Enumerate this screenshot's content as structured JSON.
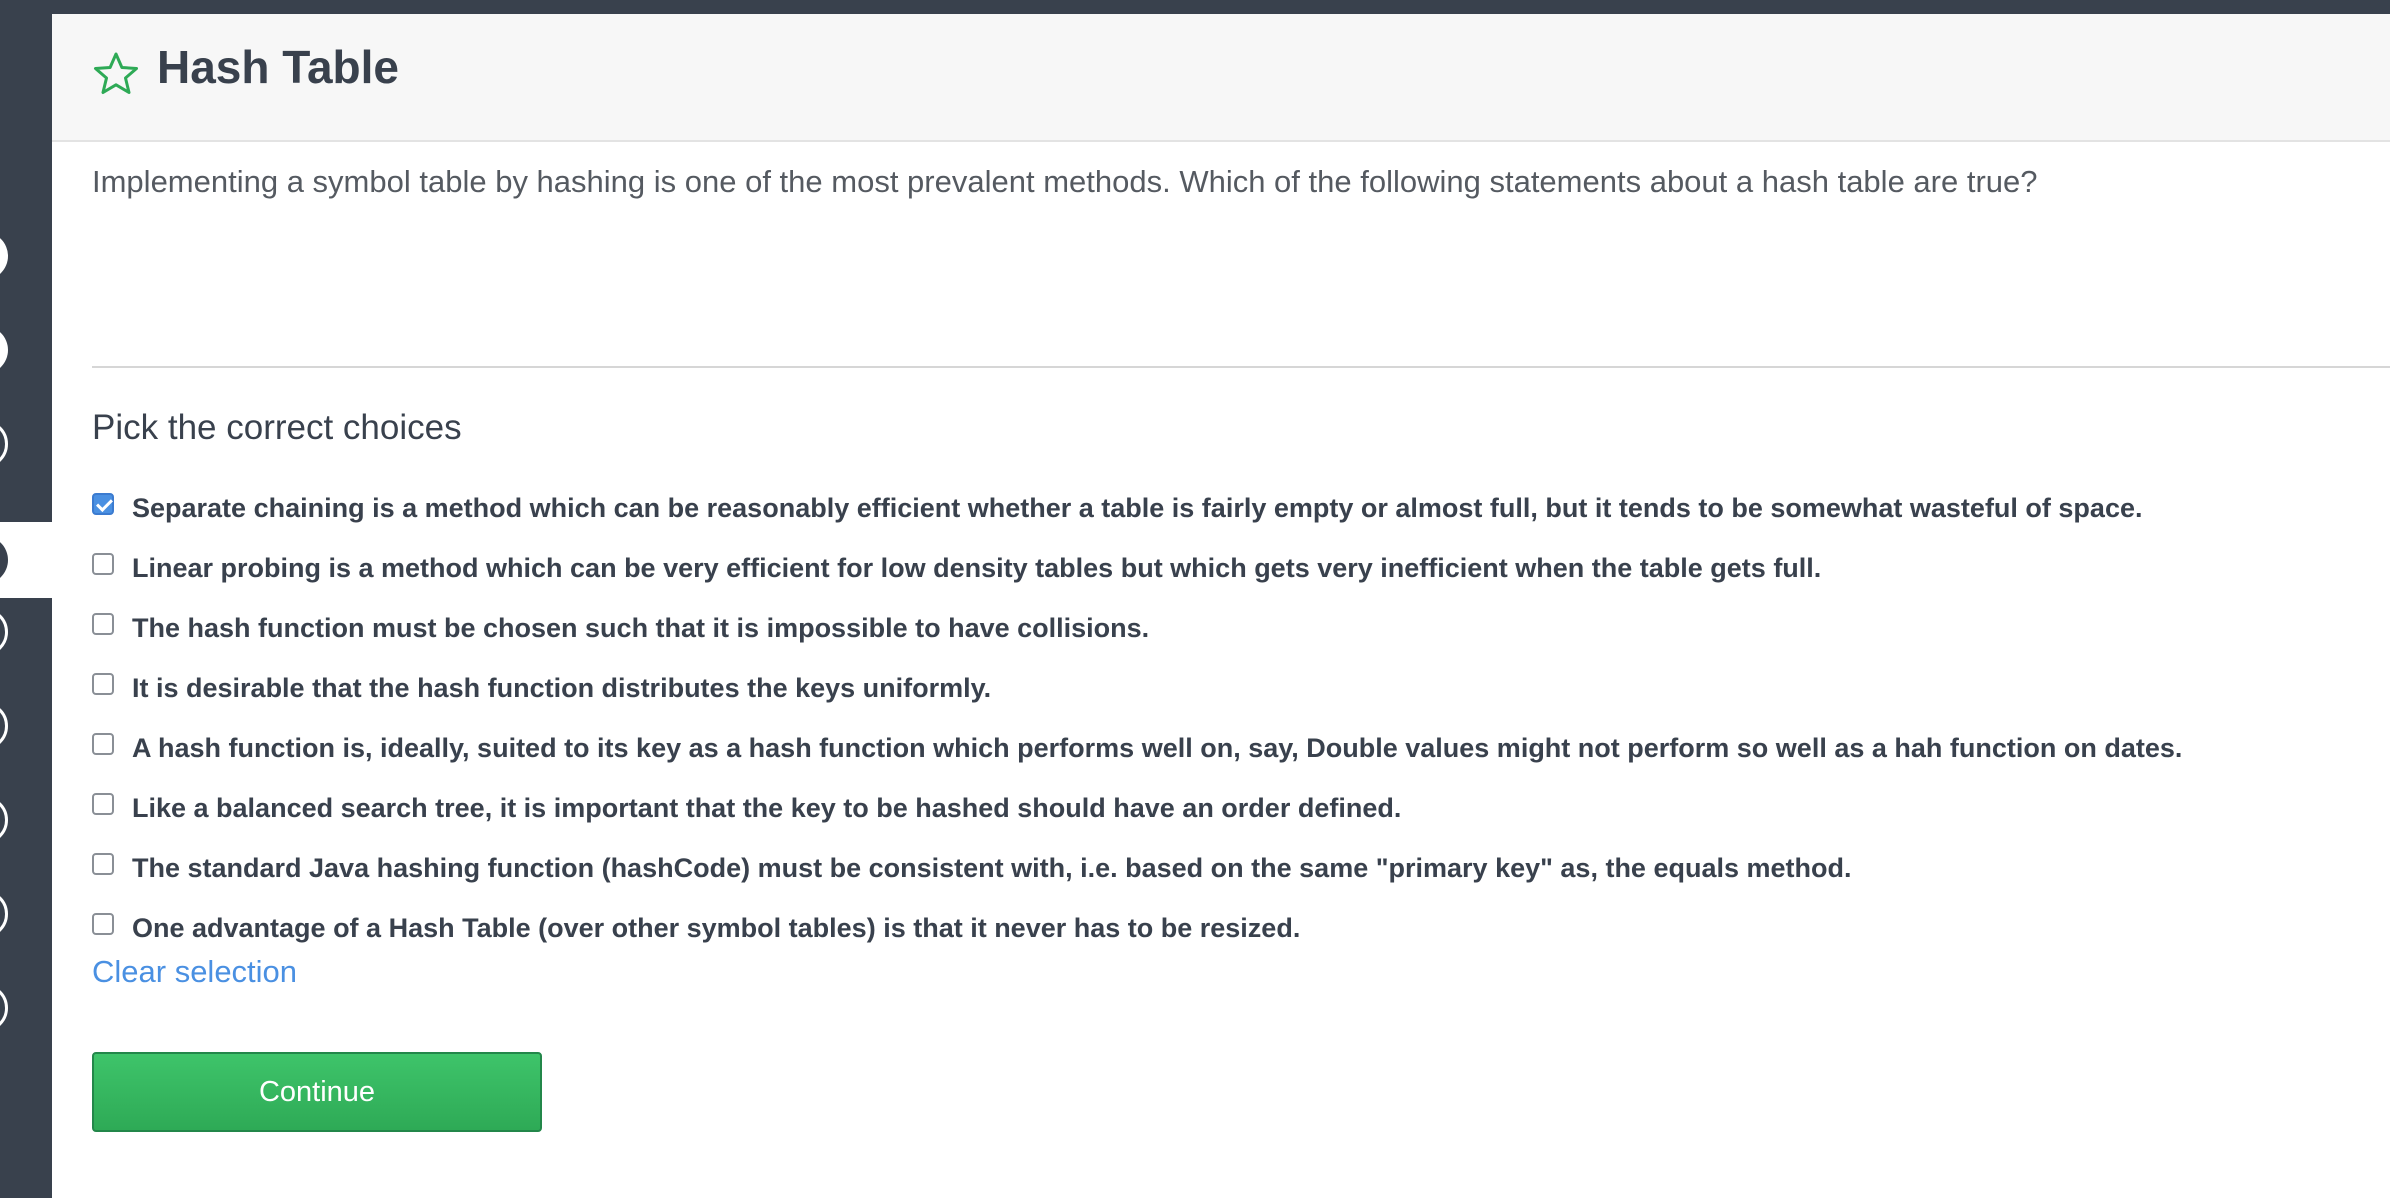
{
  "header": {
    "title": "Hash Table",
    "icon": "star-outline-icon",
    "icon_color": "#2eaa56"
  },
  "question": {
    "text": "Implementing a symbol table by hashing is one of the most prevalent methods. Which of the following statements about a hash table are true?"
  },
  "choices_section": {
    "heading": "Pick the correct choices",
    "items": [
      {
        "label": "Separate chaining is a method which can be reasonably efficient whether a table is fairly empty or almost full, but it tends to be somewhat wasteful of space.",
        "checked": true
      },
      {
        "label": "Linear probing is a method which can be very efficient for low density tables but which gets very inefficient when the table gets full.",
        "checked": false
      },
      {
        "label": "The hash function must be chosen such that it is impossible to have collisions.",
        "checked": false
      },
      {
        "label": "It is desirable that the hash function distributes the keys uniformly.",
        "checked": false
      },
      {
        "label": "A hash function is, ideally, suited to its key as a hash function which performs well on, say, Double values might not perform so well as a hah function on dates.",
        "checked": false
      },
      {
        "label": "Like a balanced search tree, it is important that the key to be hashed should have an order defined.",
        "checked": false
      },
      {
        "label": "The standard Java hashing function (hashCode) must be consistent with, i.e. based on the same \"primary key\" as, the equals method.",
        "checked": false
      },
      {
        "label": "One advantage of a Hash Table (over other symbol tables) is that it never has to be resized.",
        "checked": false
      }
    ],
    "clear_label": "Clear selection"
  },
  "actions": {
    "continue_label": "Continue"
  },
  "colors": {
    "sidebar": "#39414d",
    "accent_blue": "#4a90e2",
    "button_green": "#2eaa56"
  }
}
